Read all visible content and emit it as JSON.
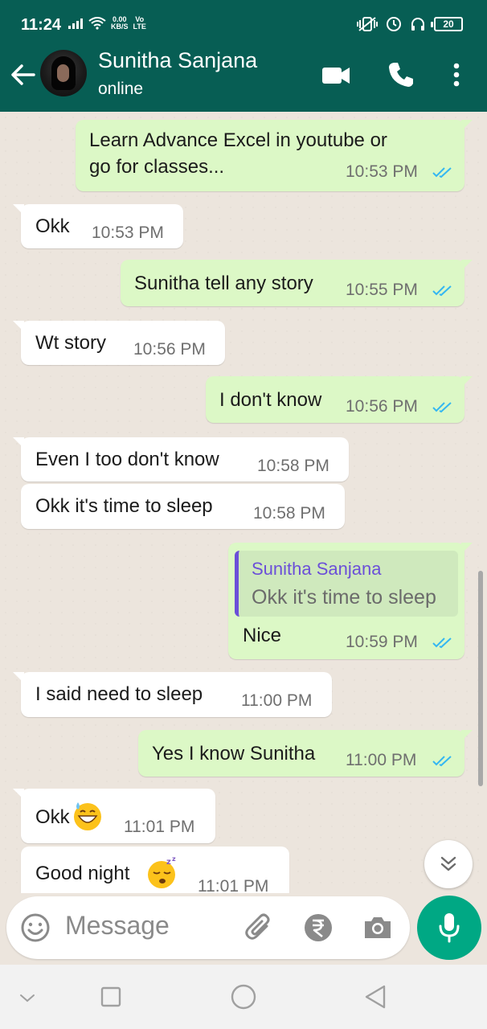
{
  "status_bar": {
    "time": "11:24",
    "net_speed": "0.00",
    "net_unit": "KB/S",
    "net_type": "Vo",
    "net_type2": "LTE",
    "battery": "20"
  },
  "header": {
    "contact_name": "Sunitha Sanjana",
    "contact_status": "online"
  },
  "messages": [
    {
      "dir": "out",
      "text_line1": "Learn Advance Excel in youtube or",
      "text_line2": "go for classes...",
      "time": "10:53 PM"
    },
    {
      "dir": "in",
      "text": "Okk",
      "time": "10:53 PM"
    },
    {
      "dir": "out",
      "text": "Sunitha tell any story",
      "time": "10:55 PM"
    },
    {
      "dir": "in",
      "text": "Wt story",
      "time": "10:56 PM"
    },
    {
      "dir": "out",
      "text": "I don't know",
      "time": "10:56 PM"
    },
    {
      "dir": "in",
      "text": "Even I too don't know",
      "time": "10:58 PM"
    },
    {
      "dir": "in",
      "text": "Okk it's time to sleep",
      "time": "10:58 PM"
    },
    {
      "dir": "out",
      "quote_name": "Sunitha Sanjana",
      "quote_text": "Okk it's time to sleep",
      "text": "Nice",
      "time": "10:59 PM"
    },
    {
      "dir": "in",
      "text": "I said need to sleep",
      "time": "11:00 PM"
    },
    {
      "dir": "out",
      "text": "Yes I know Sunitha",
      "time": "11:00 PM"
    },
    {
      "dir": "in",
      "text": "Okk",
      "emoji": "grinning-sweat-emoji",
      "time": "11:01 PM"
    },
    {
      "dir": "in",
      "text": "Good night",
      "emoji": "sleeping-emoji",
      "time": "11:01 PM"
    }
  ],
  "composer": {
    "placeholder": "Message"
  },
  "colors": {
    "header": "#075e54",
    "outgoing_bubble": "#dcf8c6",
    "incoming_bubble": "#ffffff",
    "read_tick": "#34b7f1",
    "mic_button": "#00a884",
    "quote_accent": "#6b4fd8"
  },
  "icons": {
    "back": "arrow-left-icon",
    "video_call": "video-camera-icon",
    "voice_call": "phone-icon",
    "menu": "more-vertical-icon",
    "emoji": "smiley-icon",
    "attach": "paperclip-icon",
    "payment": "rupee-icon",
    "camera": "camera-icon",
    "mic": "microphone-icon",
    "scroll_down": "chevron-double-down-icon"
  }
}
